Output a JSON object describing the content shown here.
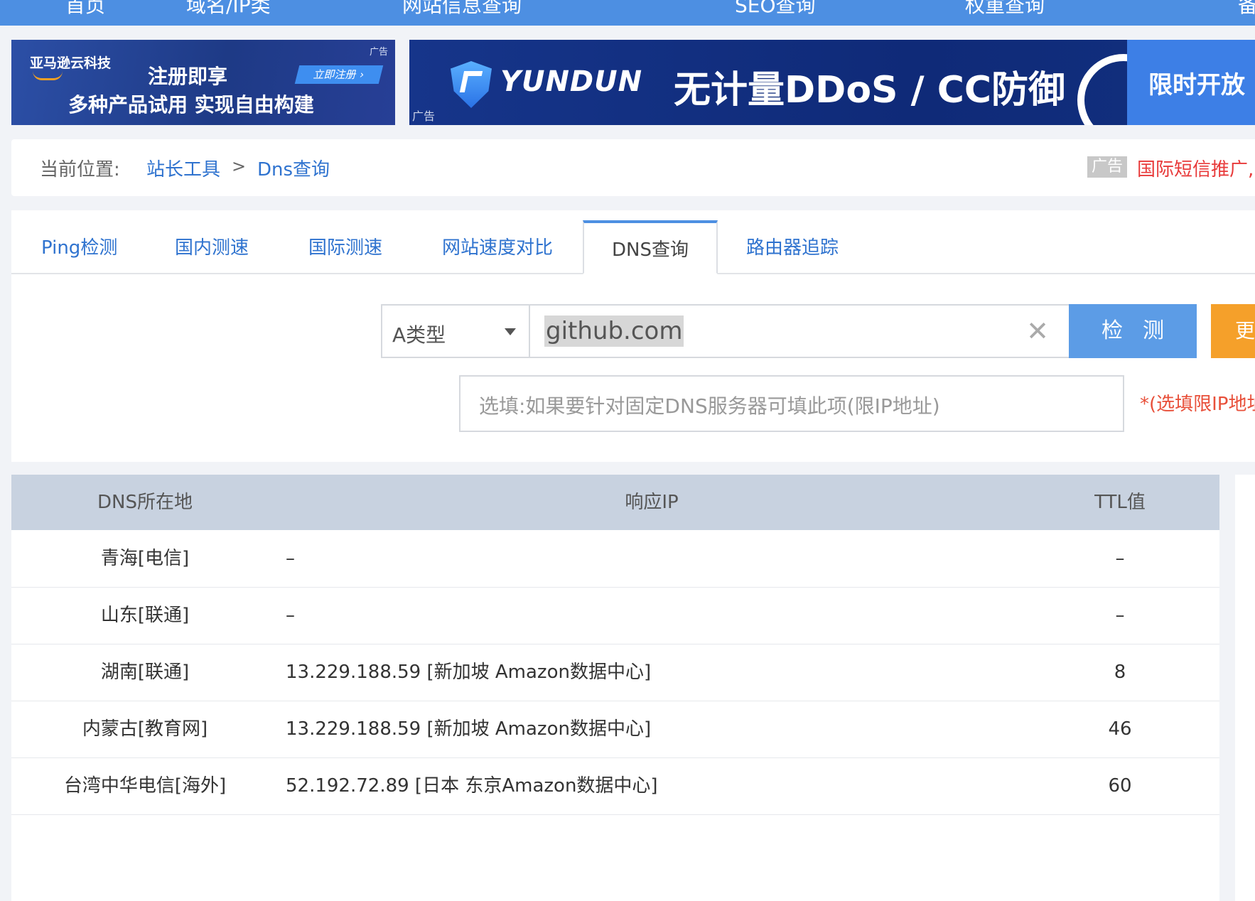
{
  "topnav": {
    "items": [
      "首页",
      "域名/IP类",
      "网站信息查询",
      "SEO查询",
      "权重查询",
      "备"
    ]
  },
  "ads": {
    "left": {
      "brand": "亚马逊云科技",
      "headline": "注册即享",
      "cta": "立即注册 ›",
      "subline": "多种产品试用 实现自由构建",
      "tag": "广告"
    },
    "right": {
      "logo_text": "YUNDUN",
      "headline": "无计量DDoS / CC防御",
      "promo": "限时开放",
      "tag": "广告"
    }
  },
  "breadcrumb": {
    "label": "当前位置:",
    "home": "站长工具",
    "separator": ">",
    "current": "Dns查询",
    "ad_tag": "广告",
    "ad_text": "国际短信推广,"
  },
  "tabs": [
    {
      "label": "Ping检测",
      "active": false
    },
    {
      "label": "国内测速",
      "active": false
    },
    {
      "label": "国际测速",
      "active": false
    },
    {
      "label": "网站速度对比",
      "active": false
    },
    {
      "label": "DNS查询",
      "active": true
    },
    {
      "label": "路由器追踪",
      "active": false
    }
  ],
  "query": {
    "record_type": "A类型",
    "domain_value": "github.com",
    "check_label": "检测",
    "more_label": "更多",
    "dns_placeholder": "选填:如果要针对固定DNS服务器可填此项(限IP地址)",
    "dns_note": "*(选填限IP地址)"
  },
  "table": {
    "headers": {
      "location": "DNS所在地",
      "ip": "响应IP",
      "ttl": "TTL值"
    },
    "rows": [
      {
        "location": "青海[电信]",
        "ip": "–",
        "ttl": "–"
      },
      {
        "location": "山东[联通]",
        "ip": "–",
        "ttl": "–"
      },
      {
        "location": "湖南[联通]",
        "ip": "13.229.188.59 [新加坡 Amazon数据中心]",
        "ttl": "8"
      },
      {
        "location": "内蒙古[教育网]",
        "ip": "13.229.188.59 [新加坡 Amazon数据中心]",
        "ttl": "46"
      },
      {
        "location": "台湾中华电信[海外]",
        "ip": "52.192.72.89 [日本 东京Amazon数据中心]",
        "ttl": "60"
      }
    ]
  },
  "colors": {
    "nav_blue": "#4d8fe2",
    "link_blue": "#2f73cf",
    "check_button": "#5c9ce6",
    "more_button": "#f5a02a",
    "table_header": "#c8d2e0",
    "note_red": "#e8503a"
  }
}
